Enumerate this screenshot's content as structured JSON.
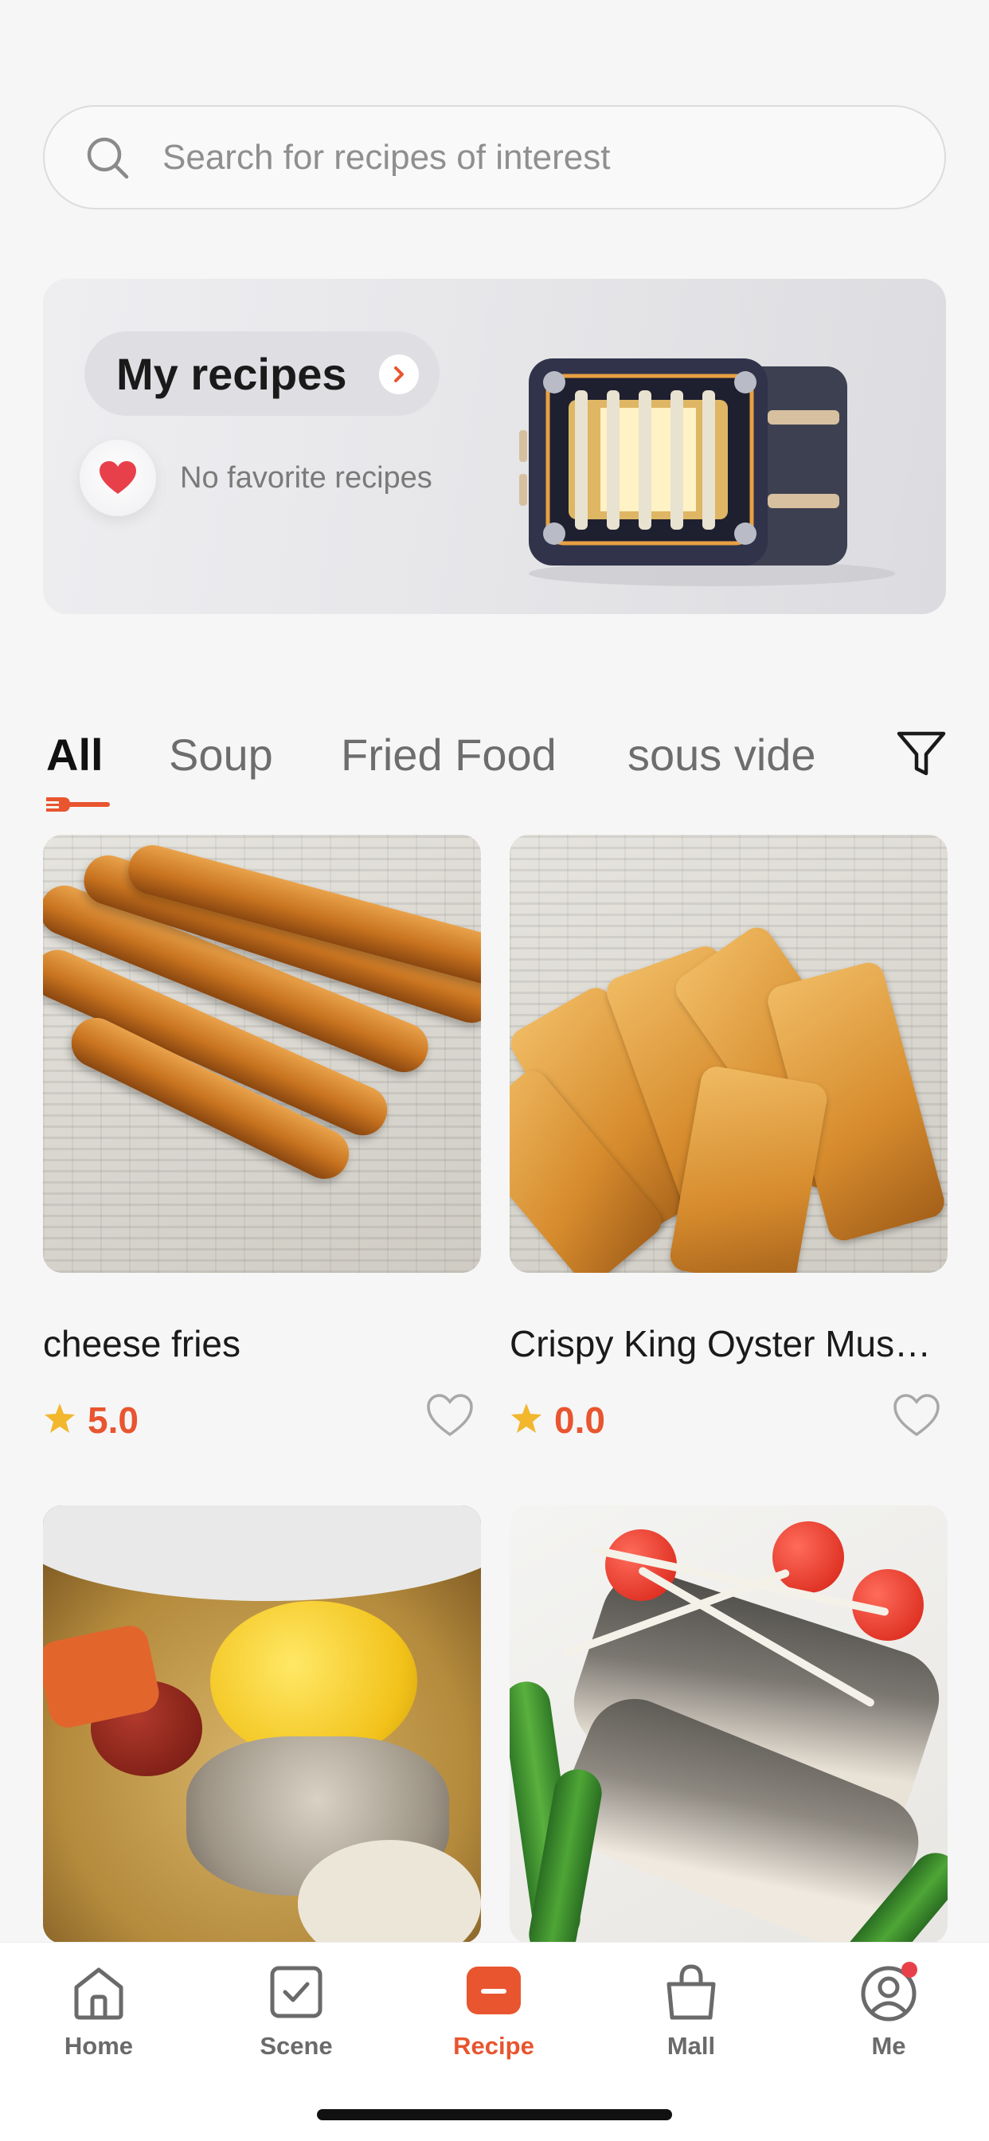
{
  "search": {
    "placeholder": "Search for recipes of interest"
  },
  "banner": {
    "title": "My recipes",
    "favorite_status": "No favorite recipes"
  },
  "tabs": [
    {
      "label": "All",
      "active": true
    },
    {
      "label": "Soup",
      "active": false
    },
    {
      "label": "Fried Food",
      "active": false
    },
    {
      "label": "sous vide",
      "active": false
    }
  ],
  "recipes": [
    {
      "title": "cheese fries",
      "rating": "5.0",
      "favorited": false
    },
    {
      "title": "Crispy King Oyster Mushroom",
      "rating": "0.0",
      "favorited": false
    },
    {
      "title": "",
      "rating": "",
      "favorited": false
    },
    {
      "title": "",
      "rating": "",
      "favorited": false
    }
  ],
  "nav": {
    "items": [
      {
        "label": "Home",
        "icon": "home-icon",
        "active": false
      },
      {
        "label": "Scene",
        "icon": "scene-icon",
        "active": false
      },
      {
        "label": "Recipe",
        "icon": "recipe-icon",
        "active": true
      },
      {
        "label": "Mall",
        "icon": "mall-icon",
        "active": false
      },
      {
        "label": "Me",
        "icon": "me-icon",
        "active": false,
        "has_notification": true
      }
    ]
  },
  "colors": {
    "accent": "#e8552f",
    "star": "#f2b72d",
    "heart": "#e8404a",
    "background": "#f6f6f6"
  }
}
